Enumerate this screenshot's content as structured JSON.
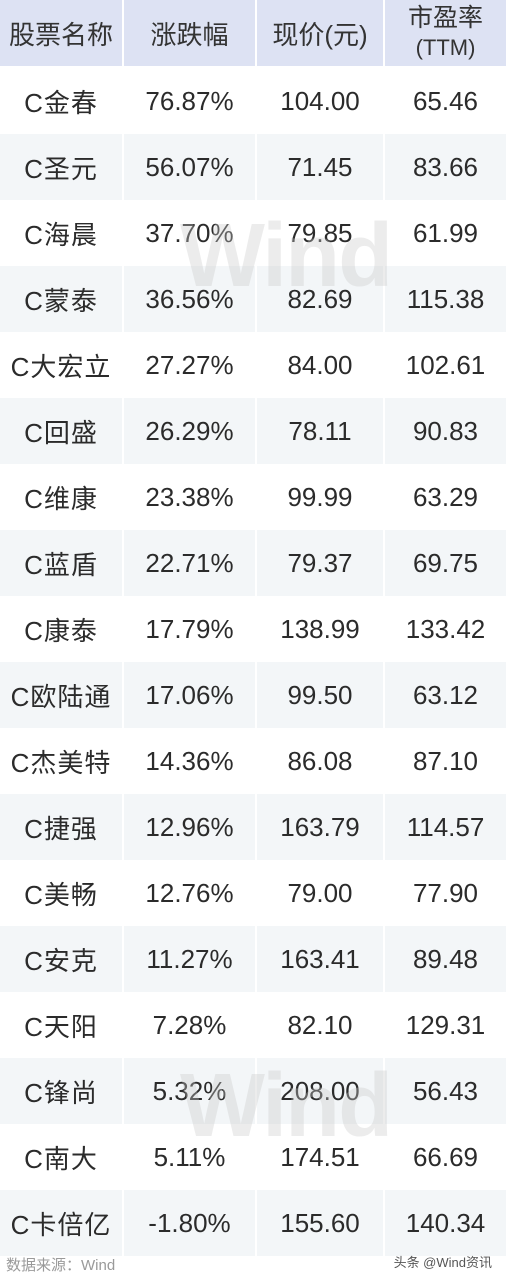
{
  "header": {
    "col_name": "股票名称",
    "col_change": "涨跌幅",
    "col_price": "现价(元)",
    "col_pe_line1": "市盈率",
    "col_pe_line2": "(TTM)"
  },
  "rows": [
    {
      "name": "C金春",
      "change": "76.87%",
      "price": "104.00",
      "pe": "65.46"
    },
    {
      "name": "C圣元",
      "change": "56.07%",
      "price": "71.45",
      "pe": "83.66"
    },
    {
      "name": "C海晨",
      "change": "37.70%",
      "price": "79.85",
      "pe": "61.99"
    },
    {
      "name": "C蒙泰",
      "change": "36.56%",
      "price": "82.69",
      "pe": "115.38"
    },
    {
      "name": "C大宏立",
      "change": "27.27%",
      "price": "84.00",
      "pe": "102.61"
    },
    {
      "name": "C回盛",
      "change": "26.29%",
      "price": "78.11",
      "pe": "90.83"
    },
    {
      "name": "C维康",
      "change": "23.38%",
      "price": "99.99",
      "pe": "63.29"
    },
    {
      "name": "C蓝盾",
      "change": "22.71%",
      "price": "79.37",
      "pe": "69.75"
    },
    {
      "name": "C康泰",
      "change": "17.79%",
      "price": "138.99",
      "pe": "133.42"
    },
    {
      "name": "C欧陆通",
      "change": "17.06%",
      "price": "99.50",
      "pe": "63.12"
    },
    {
      "name": "C杰美特",
      "change": "14.36%",
      "price": "86.08",
      "pe": "87.10"
    },
    {
      "name": "C捷强",
      "change": "12.96%",
      "price": "163.79",
      "pe": "114.57"
    },
    {
      "name": "C美畅",
      "change": "12.76%",
      "price": "79.00",
      "pe": "77.90"
    },
    {
      "name": "C安克",
      "change": "11.27%",
      "price": "163.41",
      "pe": "89.48"
    },
    {
      "name": "C天阳",
      "change": "7.28%",
      "price": "82.10",
      "pe": "129.31"
    },
    {
      "name": "C锋尚",
      "change": "5.32%",
      "price": "208.00",
      "pe": "56.43"
    },
    {
      "name": "C南大",
      "change": "5.11%",
      "price": "174.51",
      "pe": "66.69"
    },
    {
      "name": "C卡倍亿",
      "change": "-1.80%",
      "price": "155.60",
      "pe": "140.34"
    }
  ],
  "watermark": "Wind",
  "footer": {
    "source": "数据来源：Wind",
    "credit": "头条 @Wind资讯"
  },
  "colors": {
    "header_bg": "#dde2f3",
    "alt_row_bg": "#f3f6f8",
    "text": "#2b2b2b"
  }
}
